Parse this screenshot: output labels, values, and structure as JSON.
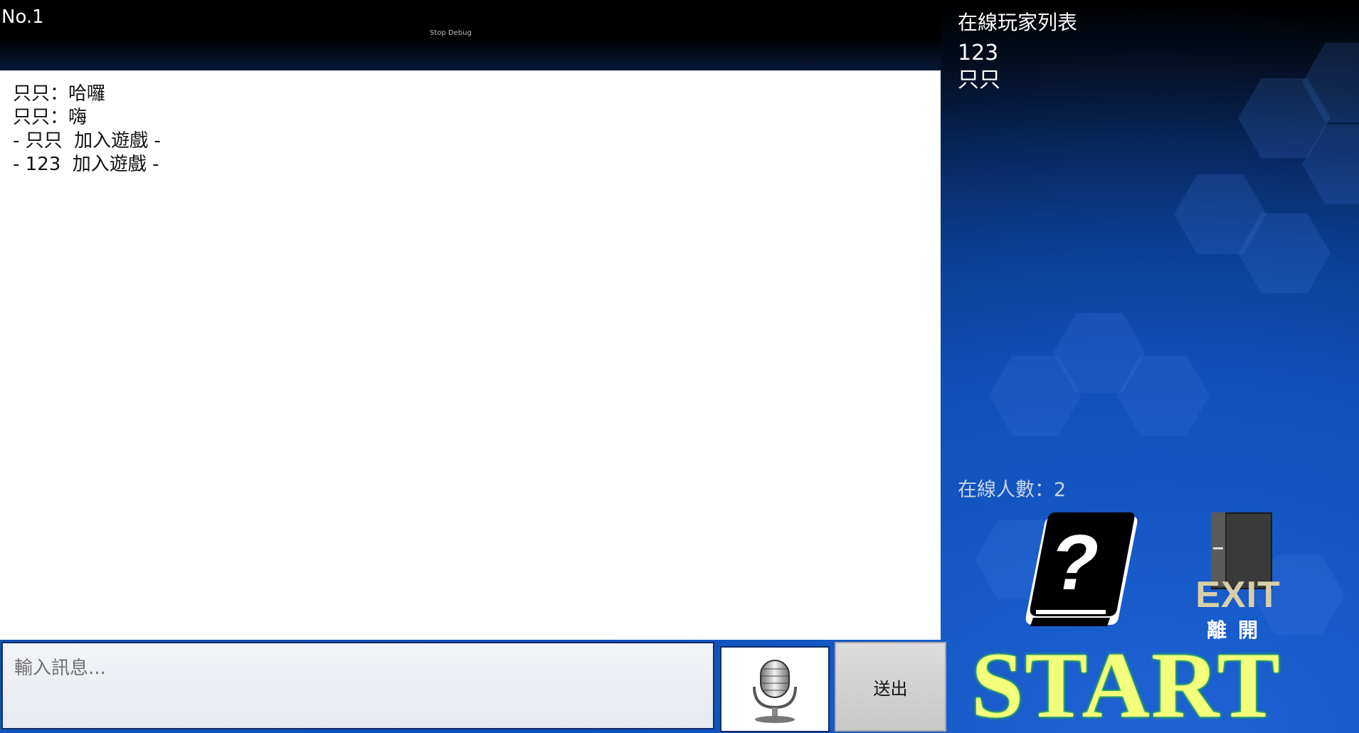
{
  "header": {
    "room_number": "No.1",
    "debug_label": "Stop Debug"
  },
  "chat": {
    "lines": [
      "只只：哈囉",
      "只只：嗨",
      "- 只只  加入遊戲 -",
      "- 123  加入遊戲 -"
    ]
  },
  "players": {
    "title": "在線玩家列表",
    "list": [
      "123",
      "只只"
    ],
    "online_count": "在線人數：2"
  },
  "actions": {
    "help_icon": "help-book-icon",
    "exit_label": "EXIT",
    "exit_sublabel": "離開",
    "start_label": "START"
  },
  "input": {
    "placeholder": "輸入訊息...",
    "value": "",
    "mic_icon": "microphone-icon",
    "send_label": "送出"
  },
  "colors": {
    "start_text": "#f3ff7a",
    "start_glow": "#6cff4a",
    "exit_text": "#d8cfa8",
    "input_border": "#0f2d6b"
  }
}
